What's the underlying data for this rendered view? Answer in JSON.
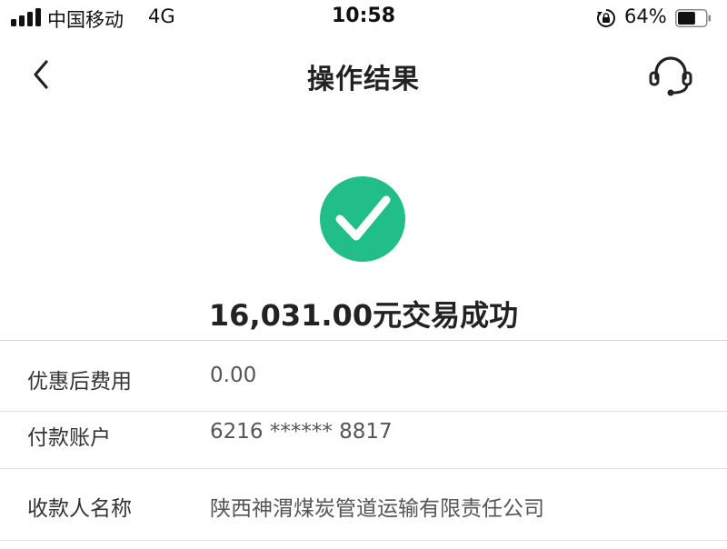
{
  "status_bar": {
    "carrier": "中国移动",
    "network": "4G",
    "time": "10:58",
    "battery": "64%",
    "battery_level": 0.64
  },
  "nav": {
    "title": "操作结果",
    "back_icon": "chevron-left-icon",
    "support_icon": "headset-icon"
  },
  "result": {
    "icon": "check-circle-icon",
    "color": "#21BE8A",
    "text": "16,031.00元交易成功"
  },
  "details": [
    {
      "label": "优惠后费用",
      "value": "0.00"
    },
    {
      "label": "付款账户",
      "value": "6216 ****** 8817"
    },
    {
      "label": "收款人名称",
      "value": "陕西神渭煤炭管道运输有限责任公司"
    }
  ]
}
